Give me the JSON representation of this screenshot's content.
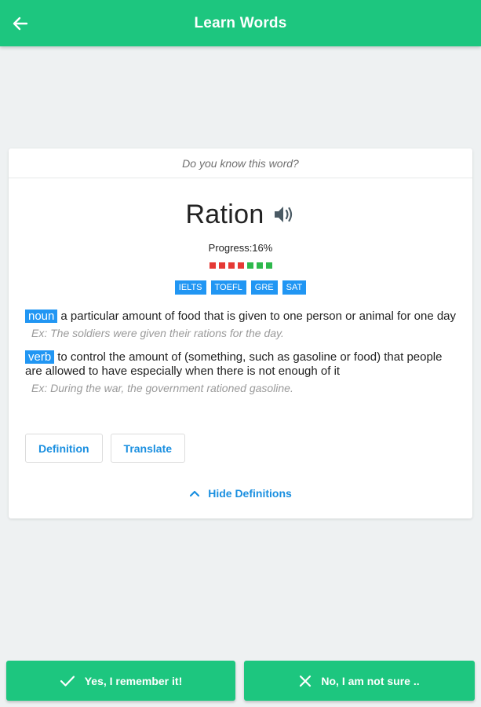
{
  "app_bar": {
    "title": "Learn Words",
    "back_icon": "arrow-left-icon"
  },
  "card": {
    "question": "Do you know this word?",
    "word": "Ration",
    "speaker_icon": "speaker-icon",
    "progress_text": "Progress:16%",
    "progress_value": 0.16,
    "progress_dots": [
      {
        "color": "#e53935"
      },
      {
        "color": "#e53935"
      },
      {
        "color": "#e53935"
      },
      {
        "color": "#e53935"
      },
      {
        "color": "#2eb84c"
      },
      {
        "color": "#2eb84c"
      },
      {
        "color": "#2eb84c"
      }
    ],
    "tags": [
      "IELTS",
      "TOEFL",
      "GRE",
      "SAT"
    ],
    "definitions": [
      {
        "pos": "noun",
        "text": "a particular amount of food that is given to one person or animal for one day",
        "example": "Ex: The soldiers were given their rations for the day."
      },
      {
        "pos": "verb",
        "text": "to control the amount of (something, such as gasoline or food) that people are allowed to have especially when there is not enough of it",
        "example": "Ex: During the war, the government rationed gasoline."
      }
    ],
    "definition_button": "Definition",
    "translate_button": "Translate",
    "hide_definitions": "Hide Definitions",
    "hide_icon": "chevron-up-icon"
  },
  "bottom": {
    "yes_label": "Yes, I remember it!",
    "yes_icon": "check-icon",
    "no_label": "No, I am not sure ..",
    "no_icon": "close-icon"
  },
  "colors": {
    "accent": "#1dc67f",
    "blue": "#2196f3",
    "link": "#1a8fe0"
  }
}
